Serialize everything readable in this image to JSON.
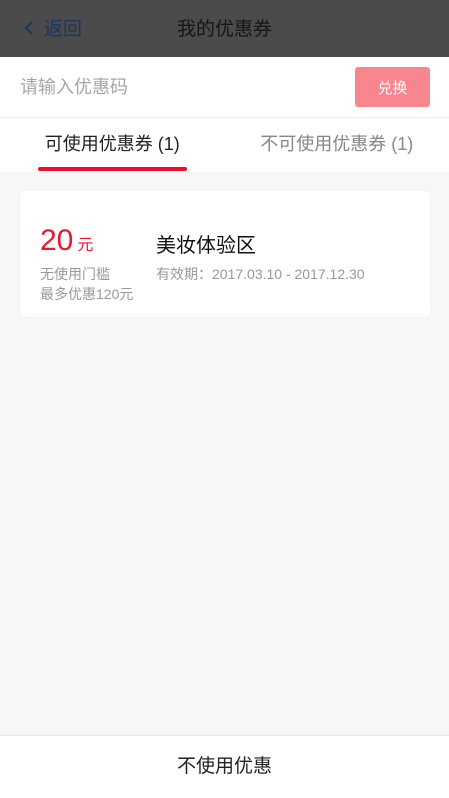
{
  "header": {
    "back_label": "返回",
    "title": "我的优惠券"
  },
  "code": {
    "placeholder": "请输入优惠码",
    "value": "",
    "redeem_label": "兑换"
  },
  "tabs": [
    {
      "label": "可使用优惠券 (1)",
      "active": true
    },
    {
      "label": "不可使用优惠券 (1)",
      "active": false
    }
  ],
  "coupons": [
    {
      "amount": "20",
      "unit": "元",
      "condition": "无使用门槛",
      "max_discount": "最多优惠120元",
      "name": "美妆体验区",
      "validity": "有效期：2017.03.10 - 2017.12.30"
    }
  ],
  "footer": {
    "label": "不使用优惠"
  },
  "colors": {
    "accent": "#ec0f2e",
    "redeem": "#f7868f",
    "header": "#4b4b4b"
  }
}
